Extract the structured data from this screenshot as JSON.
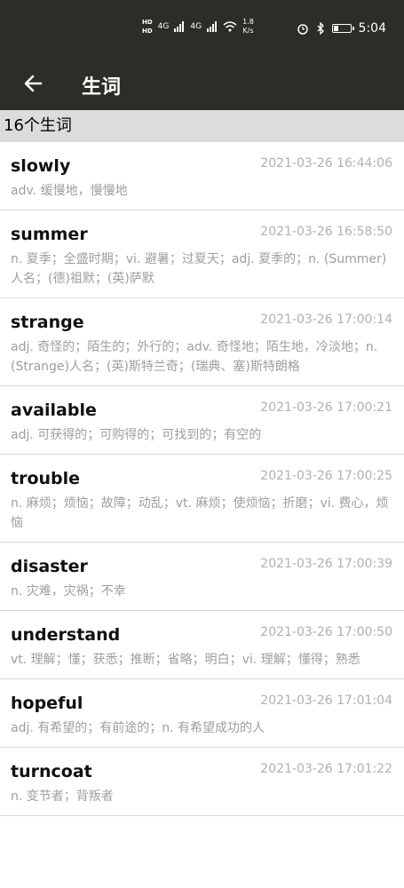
{
  "statusbar": {
    "hd1": "HD",
    "hd2": "HD",
    "net1": "4G",
    "net2": "4G",
    "speed_value": "1.8",
    "speed_unit": "K/s",
    "time": "5:04"
  },
  "appbar": {
    "title": "生词"
  },
  "count_label": "16个生词",
  "words": [
    {
      "word": "slowly",
      "time": "2021-03-26 16:44:06",
      "def": "adv. 缓慢地，慢慢地"
    },
    {
      "word": "summer",
      "time": "2021-03-26 16:58:50",
      "def": "n. 夏季；全盛时期；vi. 避暑；过夏天；adj. 夏季的；n. (Summer)人名；(德)祖默；(英)萨默"
    },
    {
      "word": "strange",
      "time": "2021-03-26 17:00:14",
      "def": "adj. 奇怪的；陌生的；外行的；adv. 奇怪地；陌生地，冷淡地；n. (Strange)人名；(英)斯特兰奇；(瑞典、塞)斯特朗格"
    },
    {
      "word": "available",
      "time": "2021-03-26 17:00:21",
      "def": "adj. 可获得的；可购得的；可找到的；有空的"
    },
    {
      "word": "trouble",
      "time": "2021-03-26 17:00:25",
      "def": "n. 麻烦；烦恼；故障；动乱；vt. 麻烦；使烦恼；折磨；vi. 费心，烦恼"
    },
    {
      "word": "disaster",
      "time": "2021-03-26 17:00:39",
      "def": "n. 灾难，灾祸；不幸"
    },
    {
      "word": "understand",
      "time": "2021-03-26 17:00:50",
      "def": "vt. 理解；懂；获悉；推断；省略；明白；vi. 理解；懂得；熟悉"
    },
    {
      "word": "hopeful",
      "time": "2021-03-26 17:01:04",
      "def": "adj. 有希望的；有前途的；n. 有希望成功的人"
    },
    {
      "word": "turncoat",
      "time": "2021-03-26 17:01:22",
      "def": "n. 变节者；背叛者"
    }
  ]
}
